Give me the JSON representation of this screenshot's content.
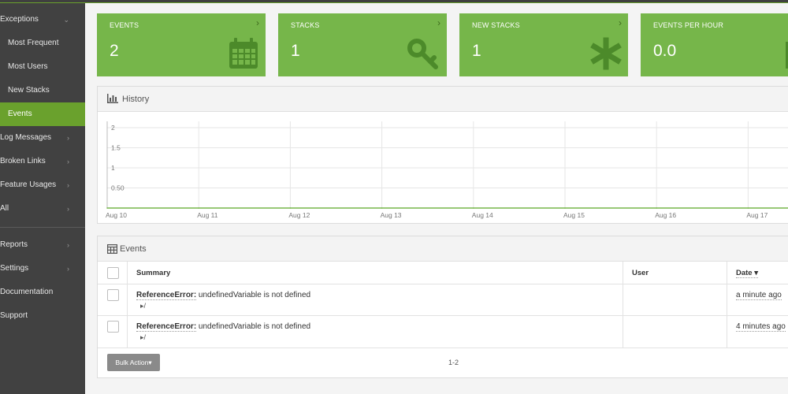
{
  "sidebar": {
    "items": [
      {
        "label": "Exceptions",
        "chevron": "⌄",
        "sub": false,
        "active": false
      },
      {
        "label": "Most Frequent",
        "chevron": "",
        "sub": true,
        "active": false
      },
      {
        "label": "Most Users",
        "chevron": "",
        "sub": true,
        "active": false
      },
      {
        "label": "New Stacks",
        "chevron": "",
        "sub": true,
        "active": false
      },
      {
        "label": "Events",
        "chevron": "",
        "sub": true,
        "active": true
      },
      {
        "label": "Log Messages",
        "chevron": "›",
        "sub": false,
        "active": false
      },
      {
        "label": "Broken Links",
        "chevron": "›",
        "sub": false,
        "active": false
      },
      {
        "label": "Feature Usages",
        "chevron": "›",
        "sub": false,
        "active": false
      },
      {
        "label": "All",
        "chevron": "›",
        "sub": false,
        "active": false
      },
      {
        "label": "Reports",
        "chevron": "›",
        "sub": false,
        "active": false
      },
      {
        "label": "Settings",
        "chevron": "›",
        "sub": false,
        "active": false
      },
      {
        "label": "Documentation",
        "chevron": "",
        "sub": false,
        "active": false
      },
      {
        "label": "Support",
        "chevron": "",
        "sub": false,
        "active": false
      }
    ]
  },
  "cards": [
    {
      "title": "EVENTS",
      "value": "2",
      "icon": "calendar-icon"
    },
    {
      "title": "STACKS",
      "value": "1",
      "icon": "key-icon"
    },
    {
      "title": "NEW STACKS",
      "value": "1",
      "icon": "asterisk-icon"
    },
    {
      "title": "EVENTS PER HOUR",
      "value": "0.0",
      "icon": "line-chart-icon"
    }
  ],
  "card_arrow": "›",
  "history": {
    "title": "History",
    "icon": "bar-chart-icon"
  },
  "chart_data": {
    "type": "line",
    "x": [
      "Aug 10",
      "Aug 11",
      "Aug 12",
      "Aug 13",
      "Aug 14",
      "Aug 15",
      "Aug 16",
      "Aug 17"
    ],
    "y_ticks": [
      "2",
      "1.5",
      "1",
      "0.50"
    ],
    "ylim": [
      0,
      2
    ],
    "series": [
      {
        "values": [
          0,
          0,
          0,
          0,
          0,
          0,
          0,
          0
        ],
        "color": "#76b64a"
      }
    ],
    "grid": true
  },
  "events_panel": {
    "title": "Events",
    "icon": "calendar-icon",
    "columns": {
      "summary": "Summary",
      "user": "User",
      "date": "Date"
    },
    "sort_indicator": "▾",
    "rows": [
      {
        "type": "ReferenceError:",
        "message": " undefinedVariable is not defined",
        "path": "/",
        "user": "",
        "date": "a minute ago"
      },
      {
        "type": "ReferenceError:",
        "message": " undefinedVariable is not defined",
        "path": "/",
        "user": "",
        "date": "4 minutes ago"
      }
    ],
    "bulk_action": "Bulk Action",
    "bulk_caret": "▾",
    "pager": "1-2"
  },
  "colors": {
    "accent": "#76b64a",
    "sidebar_bg": "#414141",
    "active_item": "#6aa12d"
  }
}
